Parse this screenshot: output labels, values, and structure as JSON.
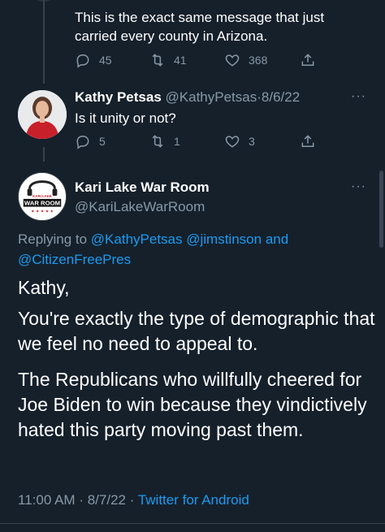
{
  "tweet_prev": {
    "text": "This is the exact same message that just carried every county in Arizona.",
    "reply_count": "45",
    "retweet_count": "41",
    "like_count": "368"
  },
  "tweet_kathy": {
    "name": "Kathy Petsas",
    "handle": "@KathyPetsas",
    "sep": "·",
    "date": "8/6/22",
    "text": "Is it unity or not?",
    "reply_count": "5",
    "retweet_count": "1",
    "like_count": "3",
    "more": "···"
  },
  "main_tweet": {
    "name": "Kari Lake War Room",
    "handle": "@KariLakeWarRoom",
    "more": "···",
    "avatar_logo_line1": "KARI LAKE",
    "avatar_logo_line2": "WAR ROOM",
    "replying_prefix": "Replying to",
    "replying_1": "@KathyPetsas",
    "replying_2": "@jimstinson",
    "replying_and": "and",
    "replying_3": "@CitizenFreePres",
    "para1": "Kathy,",
    "para2": "You're exactly the type of demographic that we feel no need to appeal to.",
    "para3": "The Republicans who willfully cheered for Joe Biden to win because they vindictively hated this party moving past them.",
    "time": "11:00 AM",
    "sep": "·",
    "date": "8/7/22",
    "source": "Twitter for Android"
  },
  "icons": [
    "reply-icon",
    "retweet-icon",
    "like-icon",
    "share-icon",
    "more-icon"
  ],
  "colors": {
    "background": "#15202b",
    "muted": "#8899a6",
    "link": "#1d9bf0",
    "text": "#ffffff",
    "avatar_red": "#c8202b"
  }
}
